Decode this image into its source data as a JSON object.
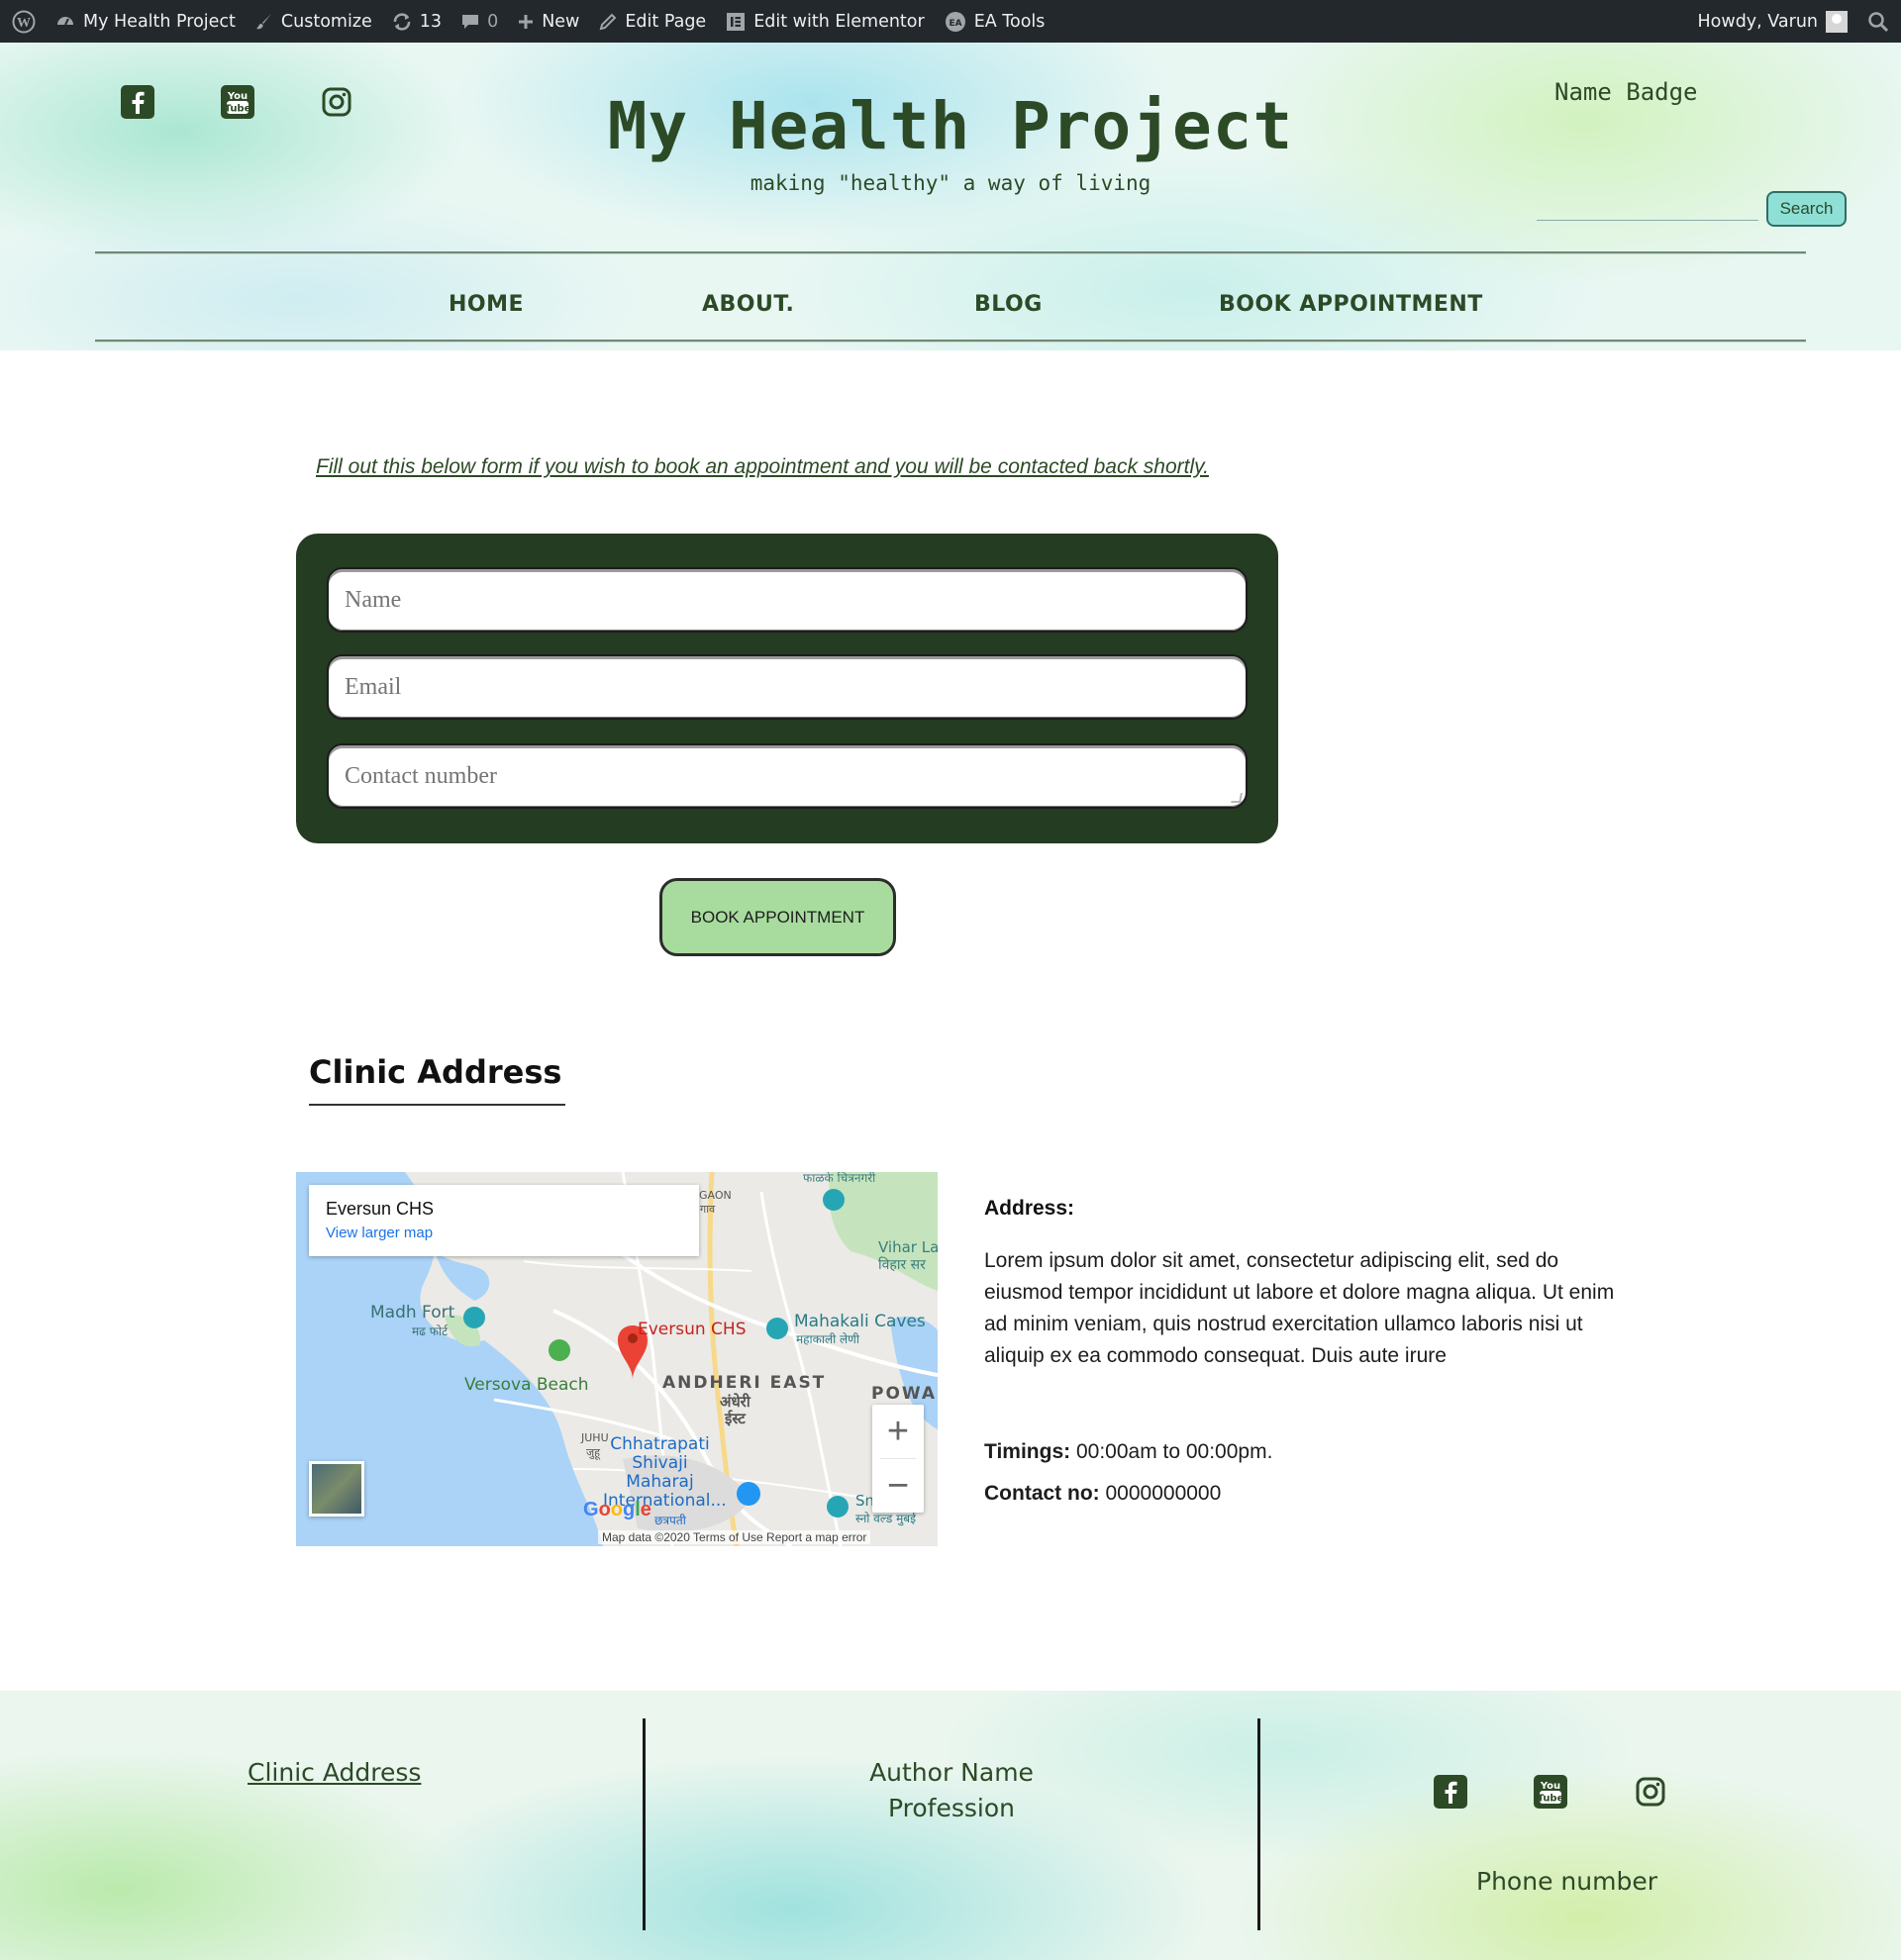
{
  "adminbar": {
    "wp_logo": "wordpress-icon",
    "site_name": "My Health Project",
    "customize": "Customize",
    "updates_count": "13",
    "comments_count": "0",
    "new": "New",
    "edit_page": "Edit Page",
    "edit_elementor": "Edit with Elementor",
    "ea_tools": "EA Tools",
    "howdy": "Howdy, Varun"
  },
  "header": {
    "title": "My Health Project",
    "tagline": "making \"healthy\" a way of living",
    "name_badge": "Name Badge",
    "search_button": "Search",
    "social": [
      "facebook-icon",
      "youtube-icon",
      "instagram-icon"
    ]
  },
  "nav": {
    "items": [
      {
        "label": "HOME"
      },
      {
        "label": "ABOUT."
      },
      {
        "label": "BLOG"
      },
      {
        "label": "BOOK APPOINTMENT"
      }
    ]
  },
  "form": {
    "intro": "Fill out this below form if you wish to book an appointment and you will be contacted back shortly.",
    "name_placeholder": "Name",
    "email_placeholder": "Email",
    "contact_placeholder": "Contact number",
    "submit": "BOOK APPOINTMENT"
  },
  "clinic": {
    "heading": "Clinic Address",
    "map": {
      "place": "Eversun CHS",
      "larger_map": "View larger map",
      "labels": {
        "madh_fort": "Madh Fort",
        "madh_fort_hi": "मढ फोर्ट",
        "versova": "Versova Beach",
        "pin_label": "Eversun CHS",
        "mahakali": "Mahakali Caves",
        "mahakali_hi": "महाकाली लेणी",
        "andheri": "ANDHERI EAST",
        "andheri_hi": "अंधेरी",
        "andheri_hi2": "ईस्ट",
        "juhu": "JUHU",
        "juhu_hi": "जुहू",
        "airport": "Chhatrapati Shivaji Maharaj International...",
        "airport_hi": "छत्रपती",
        "powai": "POWAI",
        "vihar": "Vihar La",
        "vihar_hi": "विहार सर",
        "gaon": "GAON",
        "gaon_hi": "गाव",
        "top_hi": "फाळके चित्रनगरी",
        "sn": "Sn",
        "sn_hi": "स्नो वल्ड मुबई"
      },
      "footer": "Map data ©2020    Terms of Use    Report a map error",
      "google": "Google"
    },
    "address_label": "Address:",
    "address_text": "Lorem ipsum dolor sit amet, consectetur adipiscing elit, sed do eiusmod tempor incididunt ut labore et dolore magna aliqua. Ut enim ad minim veniam, quis nostrud exercitation ullamco laboris nisi ut aliquip ex ea commodo consequat. Duis aute irure",
    "timings_label": "Timings:",
    "timings_value": " 00:00am to 00:00pm.",
    "contact_label": "Contact no:",
    "contact_value": " 0000000000"
  },
  "footer": {
    "clinic_address": "Clinic Address",
    "author_name": "Author Name",
    "profession": "Profession",
    "phone": "Phone number"
  },
  "colors": {
    "brand_green": "#2d4a27",
    "form_bg": "#243c21",
    "button_green": "#a8dc9e",
    "search_bg": "#8ee0d6"
  }
}
